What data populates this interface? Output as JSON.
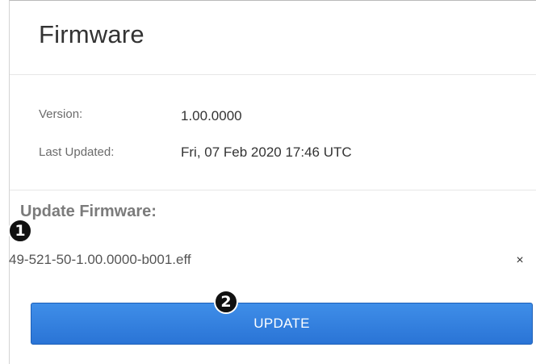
{
  "header": {
    "title": "Firmware"
  },
  "info": {
    "version_label": "Version:",
    "version_value": "1.00.0000",
    "last_updated_label": "Last Updated:",
    "last_updated_value": "Fri, 07 Feb 2020 17:46 UTC"
  },
  "update": {
    "section_title": "Update Firmware:",
    "file_name": "49-521-50-1.00.0000-b001.eff",
    "clear_symbol": "×",
    "button_label": "UPDATE"
  },
  "callouts": {
    "first": "1",
    "second": "2"
  }
}
